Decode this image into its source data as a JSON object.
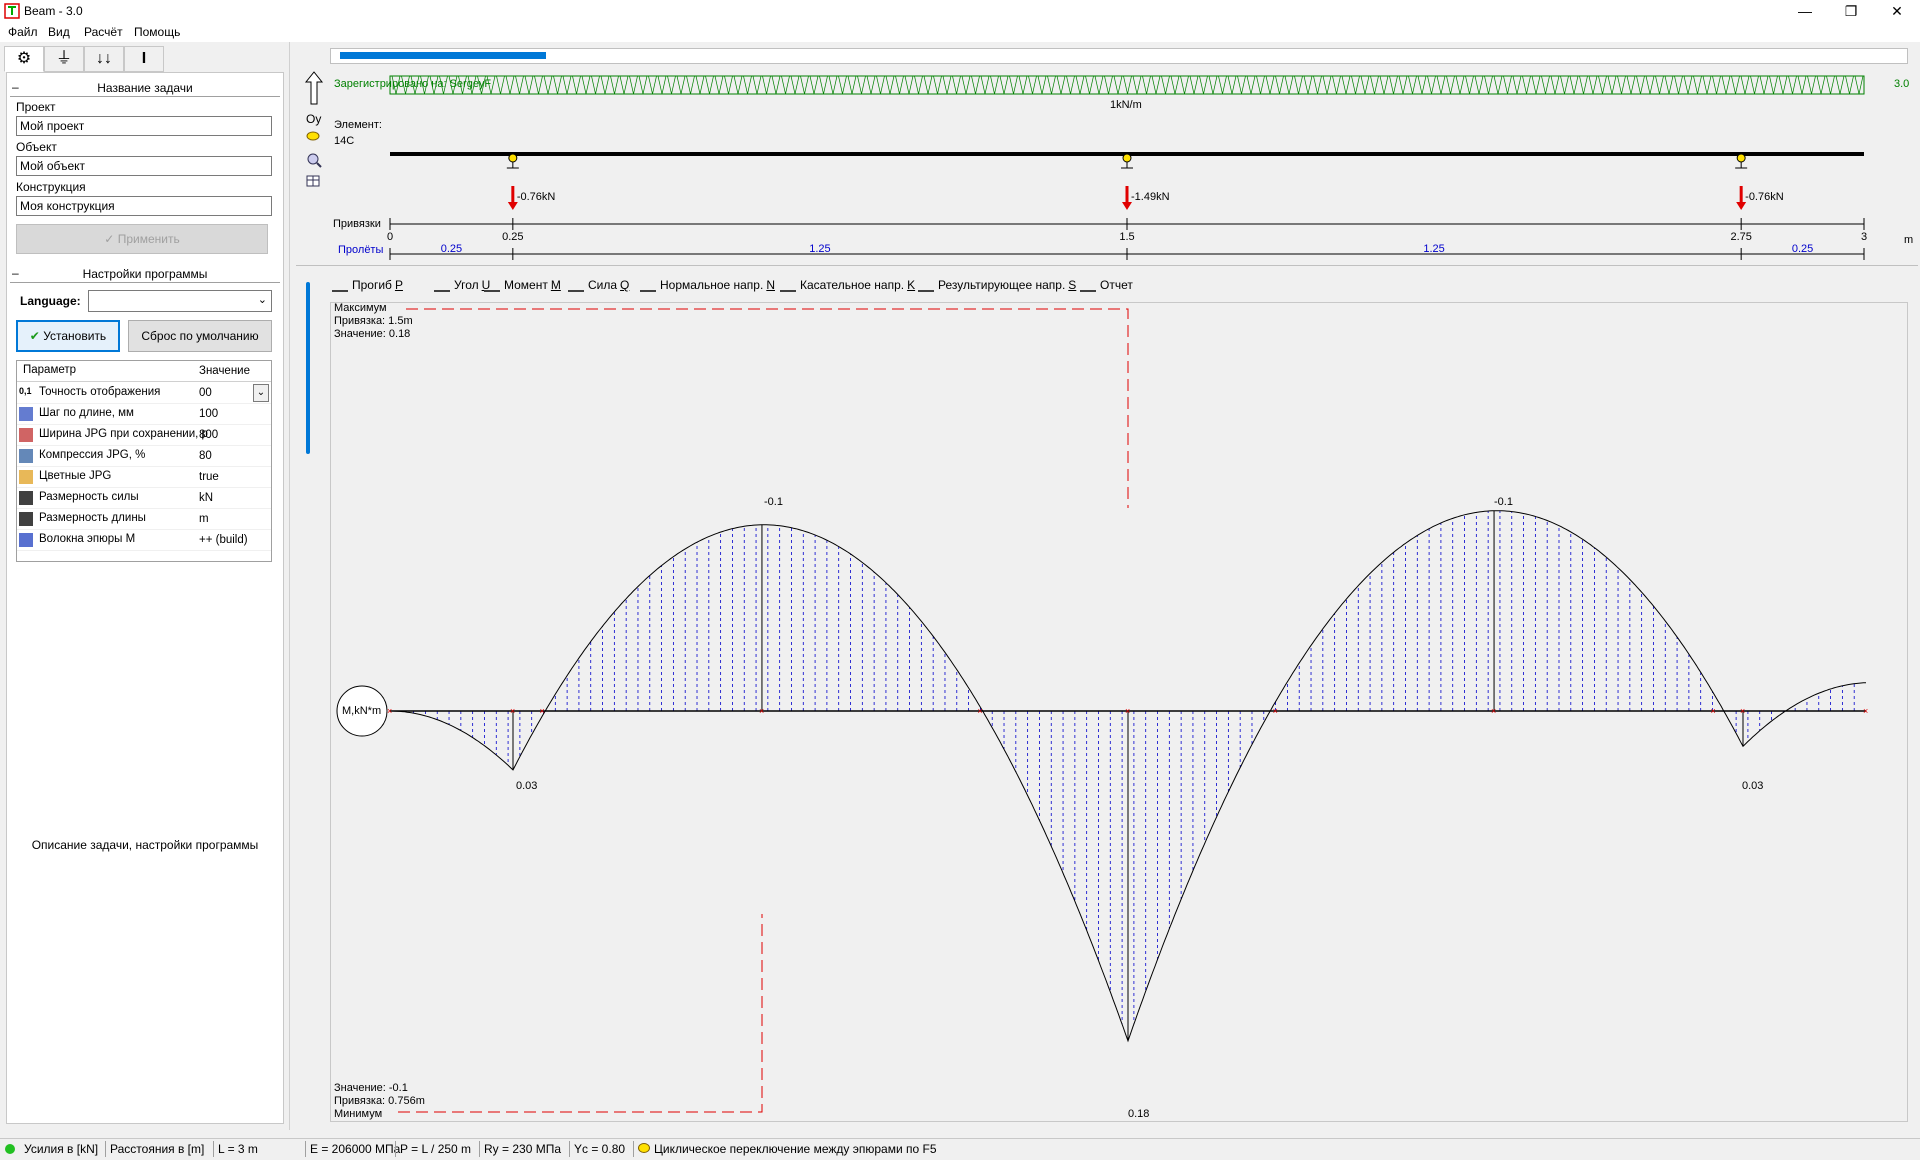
{
  "window": {
    "title": "Beam - 3.0"
  },
  "menu": [
    "Файл",
    "Вид",
    "Расчёт",
    "Помощь"
  ],
  "left": {
    "task_section": "Название задачи",
    "project_label": "Проект",
    "project_value": "Мой проект",
    "object_label": "Объект",
    "object_value": "Мой объект",
    "construction_label": "Конструкция",
    "construction_value": "Моя конструкция",
    "apply_button": "Применить",
    "settings_section": "Настройки программы",
    "language_label": "Language:",
    "language_value": "",
    "install_button": "Установить",
    "reset_button": "Сброс по умолчанию",
    "table_header_param": "Параметр",
    "table_header_value": "Значение",
    "params": [
      {
        "name": "Точность отображения",
        "value": "00",
        "icon": "precision-icon",
        "prefix": "0,1"
      },
      {
        "name": "Шаг по длине, мм",
        "value": "100",
        "icon": "step-icon"
      },
      {
        "name": "Ширина JPG при сохранении, р",
        "value": "800",
        "icon": "jpg-width-icon"
      },
      {
        "name": "Компрессия JPG, %",
        "value": "80",
        "icon": "jpg-compress-icon"
      },
      {
        "name": "Цветные JPG",
        "value": "true",
        "icon": "color-jpg-icon"
      },
      {
        "name": "Размерность силы",
        "value": "kN",
        "icon": "force-unit-icon"
      },
      {
        "name": "Размерность длины",
        "value": "m",
        "icon": "length-unit-icon"
      },
      {
        "name": "Волокна эпюры М",
        "value": "++ (build)",
        "icon": "fiber-icon"
      }
    ],
    "footer_hint": "Описание задачи, настройки программы"
  },
  "beam": {
    "registered": "Зарегистрировано на: SergeyF",
    "version": "3.0",
    "oy_label": "Oy",
    "element_label": "Элемент:",
    "element_value": "14С",
    "load_label": "1kN/m",
    "reactions": [
      "-0.76kN",
      "-1.49kN",
      "-0.76kN"
    ],
    "bindings_label": "Привязки",
    "bindings": [
      "0",
      "0.25",
      "1.5",
      "2.75",
      "3"
    ],
    "spans_label": "Пролёты",
    "spans": [
      "0.25",
      "1.25",
      "1.25",
      "0.25"
    ],
    "unit_m": "m"
  },
  "plot_tabs": [
    {
      "label": "Прогиб",
      "key": "P"
    },
    {
      "label": "Угол",
      "key": "U"
    },
    {
      "label": "Момент",
      "key": "M"
    },
    {
      "label": "Сила",
      "key": "Q"
    },
    {
      "label": "Нормальное напр.",
      "key": "N"
    },
    {
      "label": "Касательное напр.",
      "key": "K"
    },
    {
      "label": "Результирующее напр.",
      "key": "S"
    },
    {
      "label": "Отчет",
      "key": ""
    }
  ],
  "plot": {
    "max_title": "Максимум",
    "max_binding": "Привязка: 1.5m",
    "max_value": "Значение: 0.18",
    "min_value": "Значение: -0.1",
    "min_binding": "Привязка: 0.756m",
    "min_title": "Минимум",
    "unit_circle": "M,kN*m",
    "labels": [
      "-0.1",
      "-0.1",
      "0.03",
      "0.03",
      "0.18"
    ]
  },
  "status": [
    "Усилия в [kN]",
    "Расстояния в [m]",
    "L = 3 m",
    "E = 206000 МПа",
    "P = L / 250 m",
    "Ry = 230 МПа",
    "Yc = 0.80",
    "Циклическое переключение между эпюрами по F5"
  ],
  "colors": {
    "accent": "#0078d7",
    "load": "#008000",
    "reaction": "#e00000",
    "hatch": "#0000cc",
    "extreme_line": "#e00000"
  }
}
